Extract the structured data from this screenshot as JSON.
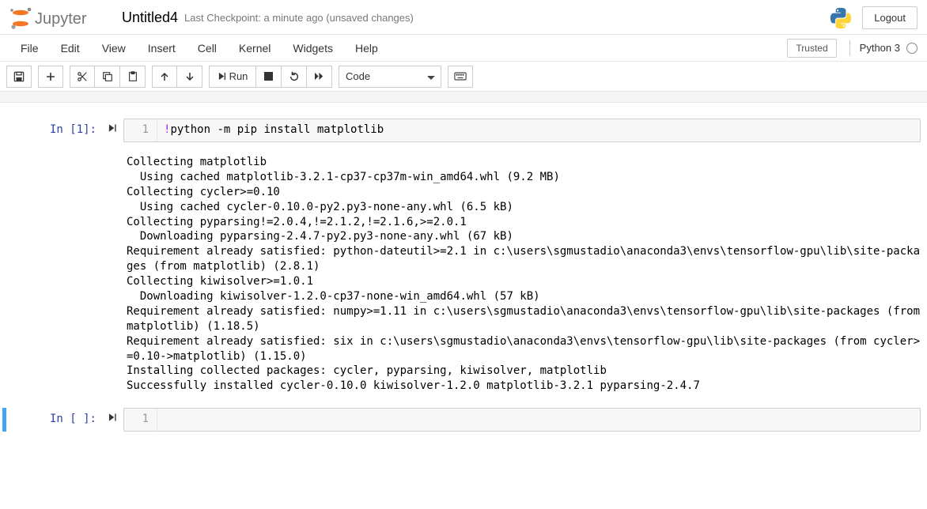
{
  "header": {
    "jupyter_wordmark": "Jupyter",
    "notebook_name": "Untitled4",
    "checkpoint": "Last Checkpoint: a minute ago   (unsaved changes)",
    "logout": "Logout"
  },
  "menubar": {
    "items": [
      "File",
      "Edit",
      "View",
      "Insert",
      "Cell",
      "Kernel",
      "Widgets",
      "Help"
    ],
    "trusted": "Trusted",
    "kernel": "Python 3"
  },
  "toolbar": {
    "save_title": "Save and Checkpoint",
    "add_title": "insert cell below",
    "cut_title": "cut selected cells",
    "copy_title": "copy selected cells",
    "paste_title": "paste cells below",
    "up_title": "move selected cells up",
    "down_title": "move selected cells down",
    "run_label": "Run",
    "stop_title": "interrupt the kernel",
    "restart_title": "restart the kernel",
    "restart_ff_title": "restart the kernel, then re-run the whole notebook",
    "cell_type": "Code",
    "cmd_palette_title": "open the command palette"
  },
  "cells": [
    {
      "prompt": "In [1]:",
      "line_no": "1",
      "code_prefix": "!",
      "code_body": "python -m pip install matplotlib",
      "output": "Collecting matplotlib\n  Using cached matplotlib-3.2.1-cp37-cp37m-win_amd64.whl (9.2 MB)\nCollecting cycler>=0.10\n  Using cached cycler-0.10.0-py2.py3-none-any.whl (6.5 kB)\nCollecting pyparsing!=2.0.4,!=2.1.2,!=2.1.6,>=2.0.1\n  Downloading pyparsing-2.4.7-py2.py3-none-any.whl (67 kB)\nRequirement already satisfied: python-dateutil>=2.1 in c:\\users\\sgmustadio\\anaconda3\\envs\\tensorflow-gpu\\lib\\site-packages (from matplotlib) (2.8.1)\nCollecting kiwisolver>=1.0.1\n  Downloading kiwisolver-1.2.0-cp37-none-win_amd64.whl (57 kB)\nRequirement already satisfied: numpy>=1.11 in c:\\users\\sgmustadio\\anaconda3\\envs\\tensorflow-gpu\\lib\\site-packages (from matplotlib) (1.18.5)\nRequirement already satisfied: six in c:\\users\\sgmustadio\\anaconda3\\envs\\tensorflow-gpu\\lib\\site-packages (from cycler>=0.10->matplotlib) (1.15.0)\nInstalling collected packages: cycler, pyparsing, kiwisolver, matplotlib\nSuccessfully installed cycler-0.10.0 kiwisolver-1.2.0 matplotlib-3.2.1 pyparsing-2.4.7"
    },
    {
      "prompt": "In [ ]:",
      "line_no": "1",
      "code_prefix": "",
      "code_body": "",
      "output": null
    }
  ]
}
